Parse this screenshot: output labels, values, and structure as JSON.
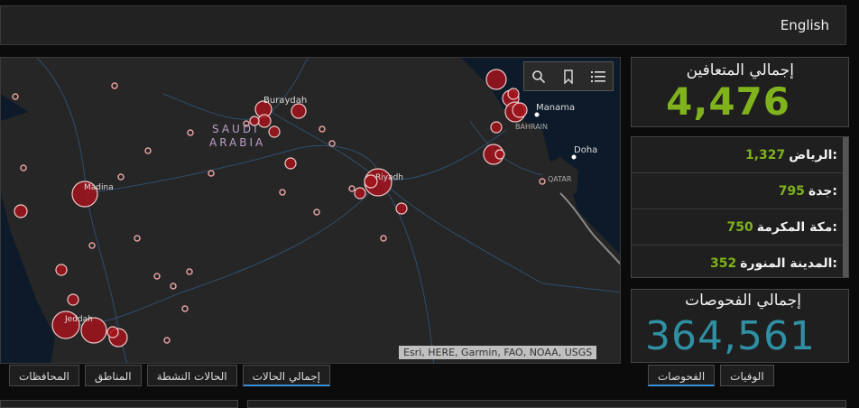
{
  "header": {
    "language_label": "English"
  },
  "map": {
    "labels": {
      "country_line1": "SAUDI",
      "country_line2": "ARABIA",
      "buraydah": "Buraydah",
      "madina": "Madina",
      "riyadh": "Riyadh",
      "jeddah": "Jeddah",
      "manama": "Manama",
      "bahrain": "BAHRAIN",
      "doha": "Doha",
      "qatar": "QATAR"
    },
    "attribution": "Esri, HERE, Garmin, FAO, NOAA, USGS",
    "toolbar": {
      "search_icon": "search-icon",
      "bookmark_icon": "bookmark-icon",
      "list_icon": "list-icon"
    },
    "colors": {
      "bubble_fill": "#a3141c",
      "bubble_stroke": "#f0c8c8"
    }
  },
  "left_tabs": [
    {
      "label": "إجمالي الحالات",
      "active": true
    },
    {
      "label": "الحالات النشطة",
      "active": false
    },
    {
      "label": "المناطق",
      "active": false
    },
    {
      "label": "المحافظات",
      "active": false
    }
  ],
  "recovered": {
    "title": "إجمالي المتعافين",
    "value": "4,476"
  },
  "regions": [
    {
      "name": "الرياض:",
      "value": "1,327"
    },
    {
      "name": "جدة:",
      "value": "795"
    },
    {
      "name": "مكة المكرمة:",
      "value": "750"
    },
    {
      "name": "المدينة المنورة:",
      "value": "352"
    }
  ],
  "tests": {
    "title": "إجمالي الفحوصات",
    "value": "364,561"
  },
  "right_tabs": [
    {
      "label": "الفحوصات",
      "active": true
    },
    {
      "label": "الوفيات",
      "active": false
    }
  ],
  "colors": {
    "green": "#7fb21d",
    "teal": "#2f8fa3",
    "accent_tab": "#3a8fd6"
  }
}
